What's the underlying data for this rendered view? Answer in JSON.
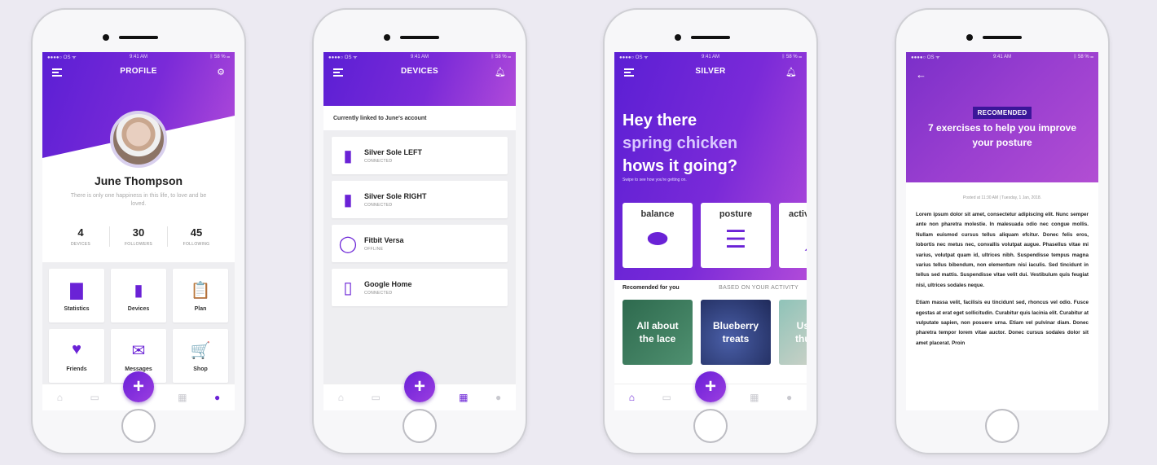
{
  "status_bar": {
    "carrier": "●●●●○ OS ᯤ",
    "time": "9:41 AM",
    "battery": "ᛒ 58 % ▭"
  },
  "tabbar_icons": [
    "home-icon",
    "calendar-icon",
    "grid-icon",
    "user-icon"
  ],
  "fab_label": "+",
  "profile": {
    "title": "PROFILE",
    "name": "June Thompson",
    "quote": "There is only one happiness in this life, to love and be loved.",
    "stats": [
      {
        "value": "4",
        "label": "DEVICES"
      },
      {
        "value": "30",
        "label": "FOLLOWERS"
      },
      {
        "value": "45",
        "label": "FOLLOWING"
      }
    ],
    "tiles": [
      {
        "label": "Statistics",
        "icon": "bar-chart-icon",
        "glyph": "▇"
      },
      {
        "label": "Devices",
        "icon": "sole-icon",
        "glyph": "▮"
      },
      {
        "label": "Plan",
        "icon": "clipboard-icon",
        "glyph": "📋"
      },
      {
        "label": "Friends",
        "icon": "heart-icon",
        "glyph": "♥"
      },
      {
        "label": "Messages",
        "icon": "envelope-icon",
        "glyph": "✉"
      },
      {
        "label": "Shop",
        "icon": "cart-icon",
        "glyph": "🛒"
      }
    ]
  },
  "devices": {
    "title": "DEVICES",
    "subtitle": "Currently linked to June's account",
    "items": [
      {
        "name": "Silver Sole LEFT",
        "status": "CONNECTED",
        "icon": "sole-icon"
      },
      {
        "name": "Silver Sole RIGHT",
        "status": "CONNECTED",
        "icon": "sole-icon"
      },
      {
        "name": "Fitbit Versa",
        "status": "OFFLINE",
        "icon": "watch-icon"
      },
      {
        "name": "Google Home",
        "status": "CONNECTED",
        "icon": "speaker-icon"
      }
    ]
  },
  "silver": {
    "title": "SILVER",
    "hero_line1": "Hey there",
    "hero_line2": "spring chicken",
    "hero_line3": "hows it going?",
    "hero_sub": "Swipe to see how you're getting on.",
    "cards": [
      {
        "label": "balance",
        "icon": "stones-icon"
      },
      {
        "label": "posture",
        "icon": "spine-icon"
      },
      {
        "label": "activ",
        "icon": "shoe-icon"
      }
    ],
    "rec_title": "Recomended for you",
    "rec_tab": "BASED ON YOUR ACTIVITY",
    "rec_cards": [
      {
        "line1": "All about",
        "line2": "the lace",
        "color": "#3f7f5f"
      },
      {
        "line1": "Blueberry",
        "line2": "treats",
        "color": "#2f3f78"
      },
      {
        "line1": "Us",
        "line2": "thu",
        "color": "#7fb0a8"
      }
    ]
  },
  "article": {
    "badge": "RECOMENDED",
    "title": "7 exercises to help you improve your posture",
    "meta": "Posted at 11:30 AM | Tuesday, 1 Jan, 2018.",
    "para1": "Lorem ipsum dolor sit amet, consectetur adipiscing elit. Nunc semper ante non pharetra molestie. In malesuada odio nec congue mollis. Nullam euismod cursus tellus aliquam efcitur. Donec felis eros, lobortis nec metus nec, convallis volutpat augue. Phasellus vitae mi varius, volutpat quam id, ultrices nibh. Suspendisse tempus magna varius tellus bibendum, non elementum nisi iaculis. Sed tincidunt in tellus sed mattis. Suspendisse vitae velit dui. Vestibulum quis feugiat nisi, ultrices sodales neque.",
    "para2": "Etiam massa velit, facilisis eu tincidunt sed, rhoncus vel odio. Fusce egestas at erat eget sollicitudin. Curabitur quis lacinia elit. Curabitur at vulputate sapien, non posuere urna. Etiam vel pulvinar diam. Donec pharetra tempor lorem vitae auctor. Donec cursus sodales dolor sit amet placerat. Proin"
  },
  "colors": {
    "accent": "#6a22d6",
    "gradient_start": "#5b1fd4",
    "gradient_end": "#b04ad9"
  }
}
